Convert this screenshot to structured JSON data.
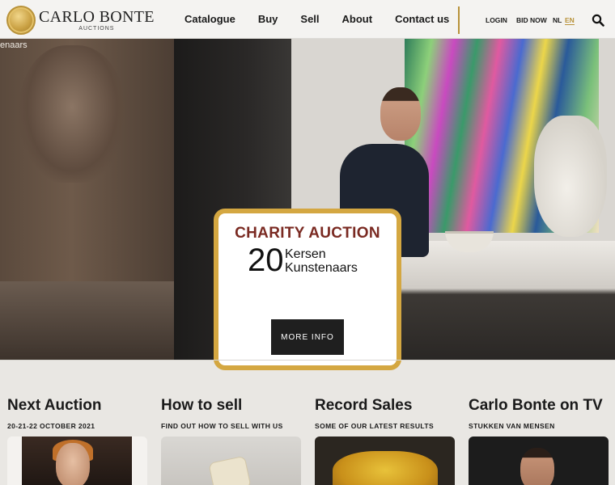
{
  "brand": {
    "name": "CARLO BONTE",
    "sub": "AUCTIONS"
  },
  "nav": {
    "items": [
      "Catalogue",
      "Buy",
      "Sell",
      "About",
      "Contact us"
    ]
  },
  "util": {
    "login": "LOGIN",
    "bid_now": "BID NOW",
    "lang_nl": "NL",
    "lang_en": "EN",
    "active_lang": "EN"
  },
  "icons": {
    "search": "search-icon"
  },
  "hero": {
    "caption": "enaars",
    "card_title": "CHARITY AUCTION",
    "card_number": "20",
    "card_line1": "Kersen",
    "card_line2": "Kunstenaars",
    "button": "MORE INFO"
  },
  "sections": [
    {
      "title": "Next Auction",
      "subtitle": "20-21-22 OCTOBER 2021"
    },
    {
      "title": "How to sell",
      "subtitle": "FIND OUT HOW TO SELL WITH US"
    },
    {
      "title": "Record Sales",
      "subtitle": "SOME OF OUR LATEST RESULTS"
    },
    {
      "title": "Carlo Bonte on TV",
      "subtitle": "STUKKEN VAN MENSEN"
    }
  ],
  "colors": {
    "gold": "#b8923a",
    "card_border": "#d4a741",
    "card_title": "#7a2a22",
    "button_bg": "#1f1f1f"
  }
}
